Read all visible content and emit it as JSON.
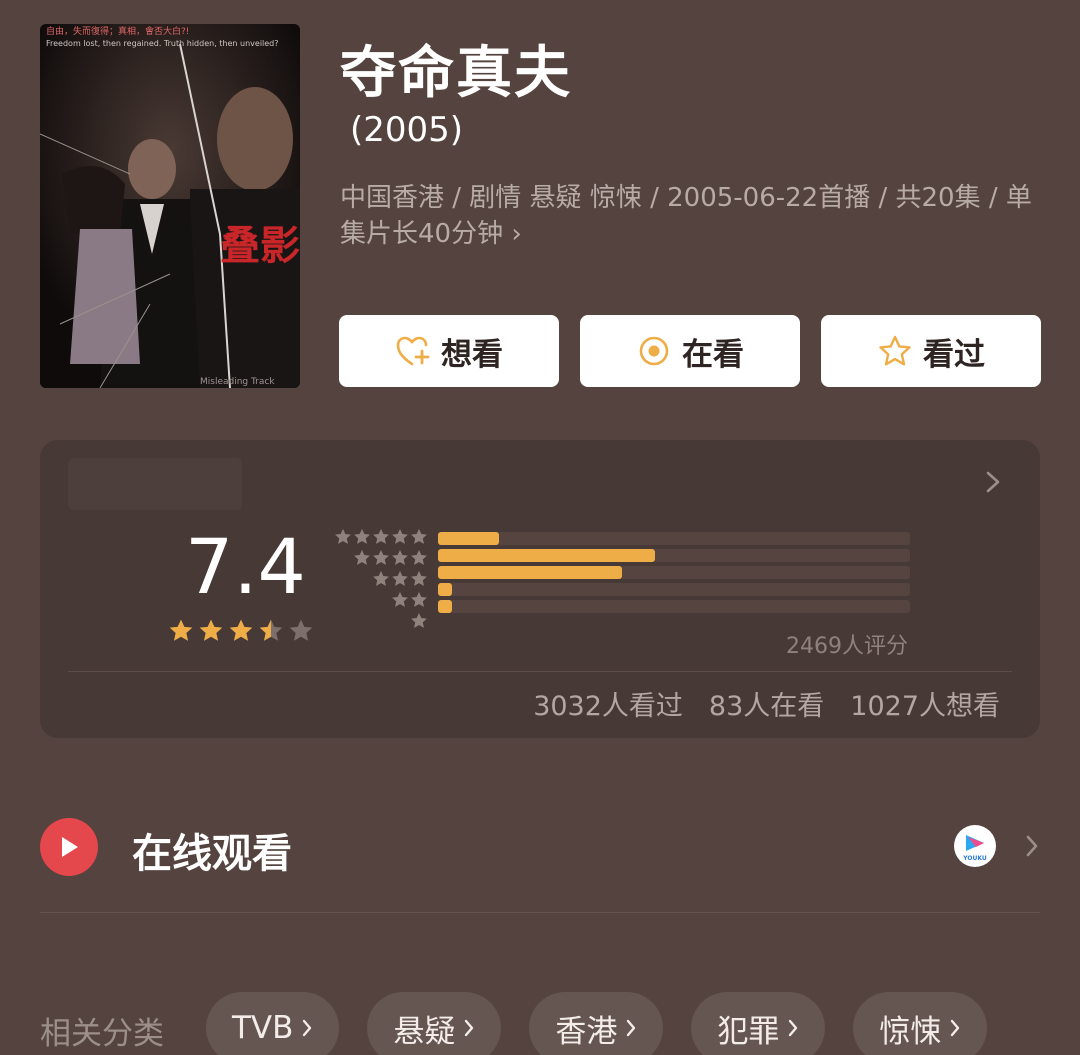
{
  "poster": {
    "top_caption": "自由，失而復得；真相，會否大白?!",
    "top_caption_en": "Freedom lost, then regained. Truth hidden, then unveiled?",
    "title_art": "叠影危情",
    "bottom_caption": "Misleading Track"
  },
  "header": {
    "title": "夺命真夫",
    "year": "(2005)",
    "meta_line": "中国香港 / 剧情 悬疑 惊悚 / 2005-06-22首播 / 共20集 / 单集片长40分钟 ›"
  },
  "actions": [
    {
      "label": "想看",
      "icon": "heart-plus-icon"
    },
    {
      "label": "在看",
      "icon": "target-circle-icon"
    },
    {
      "label": "看过",
      "icon": "star-outline-icon"
    }
  ],
  "rating": {
    "score": "7.4",
    "stars_filled": 3.5,
    "stars_total": 5,
    "distribution": [
      {
        "stars": 5,
        "fraction": 0.13
      },
      {
        "stars": 4,
        "fraction": 0.46
      },
      {
        "stars": 3,
        "fraction": 0.39
      },
      {
        "stars": 2,
        "fraction": 0.03
      },
      {
        "stars": 1,
        "fraction": 0.03
      }
    ],
    "rating_count": "2469人评分",
    "watched": "3032人看过",
    "watching": "83人在看",
    "want": "1027人想看"
  },
  "watch": {
    "label": "在线观看",
    "provider_icon": "youku-logo-icon",
    "provider_text": "YOUKU"
  },
  "tags": {
    "label": "相关分类",
    "items": [
      "TVB",
      "悬疑",
      "香港",
      "犯罪",
      "惊悚"
    ]
  },
  "colors": {
    "background": "#54433e",
    "card": "#473935",
    "bar": "#efad47",
    "play": "#e4474c",
    "tag_bg": "#655651"
  }
}
